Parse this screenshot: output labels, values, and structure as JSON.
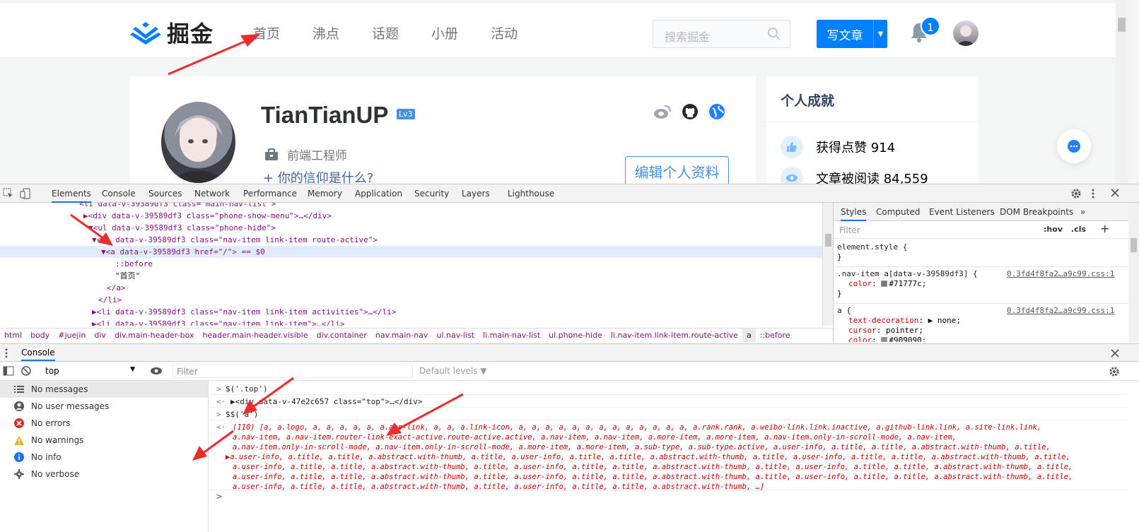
{
  "site": {
    "logo_text": "掘金",
    "nav": [
      "首页",
      "沸点",
      "话题",
      "小册",
      "活动"
    ],
    "search_placeholder": "搜索掘金",
    "write_button": "写文章",
    "notification_count": "1"
  },
  "profile": {
    "name": "TianTianUP",
    "level": "Lv3",
    "job": "前端工程师",
    "belief": "+ 你的信仰是什么?",
    "edit_button": "编辑个人资料"
  },
  "achievements": {
    "title": "个人成就",
    "likes": "获得点赞 914",
    "reads": "文章被阅读 84,559"
  },
  "devtools": {
    "tabs": [
      "Elements",
      "Console",
      "Sources",
      "Network",
      "Performance",
      "Memory",
      "Application",
      "Security",
      "Layers",
      "Lighthouse"
    ],
    "elements": [
      {
        "indent": 112,
        "html": "<li data-v-39589df3 class=\"main-nav-list\">"
      },
      {
        "indent": 118,
        "html": "▶<div data-v-39589df3 class=\"phone-show-menu\">…</div>"
      },
      {
        "indent": 125,
        "html": "▼<ul data-v-39589df3 class=\"phone-hide\">"
      },
      {
        "indent": 130,
        "html": "▼<li data-v-39589df3 class=\"nav-item link-item route-active\">"
      },
      {
        "indent": 143,
        "html": "▼<a data-v-39589df3 href=\"/\"> == $0"
      },
      {
        "indent": 163,
        "html": "::before"
      },
      {
        "indent": 163,
        "html": "\"首页\""
      },
      {
        "indent": 151,
        "html": "</a>"
      },
      {
        "indent": 139,
        "html": "</li>"
      },
      {
        "indent": 130,
        "html": "▶<li data-v-39589df3 class=\"nav-item link-item activities\">…</li>"
      },
      {
        "indent": 130,
        "html": "▶<li data-v-39589df3 class=\"nav-item link-item\">…</li>"
      }
    ],
    "breadcrumb": [
      "html",
      "body",
      "#juejin",
      "div",
      "div.main-header-box",
      "header.main-header.visible",
      "div.container",
      "nav.main-nav",
      "ul.nav-list",
      "li.main-nav-list",
      "ul.phone-hide",
      "li.nav-item.link-item.route-active",
      "a",
      "::before"
    ],
    "styles_tabs": [
      "Styles",
      "Computed",
      "Event Listeners",
      "DOM Breakpoints",
      "»"
    ],
    "styles_filter_placeholder": "Filter",
    "hov": ":hov",
    "cls": ".cls",
    "plus": "+",
    "rules": [
      {
        "selector": "element.style {",
        "props": [],
        "close": "}",
        "source": ""
      },
      {
        "selector": ".nav-item a[data-v-39589df3] {",
        "props": [
          {
            "name": "color",
            "value": "#71777c;",
            "swatch": "#71777c"
          }
        ],
        "close": "}",
        "source": "0.3fd4f8fa2…a9c99.css:1"
      },
      {
        "selector": "a {",
        "props": [
          {
            "name": "text-decoration",
            "value": "▶ none;",
            "swatch": ""
          },
          {
            "name": "cursor",
            "value": "pointer;",
            "swatch": ""
          },
          {
            "name": "color",
            "value": "#909090;",
            "swatch": "#909090"
          }
        ],
        "close": "",
        "source": "0.3fd4f8fa2…a9c99.css:1"
      }
    ]
  },
  "console": {
    "drawer_title": "Console",
    "context": "top",
    "filter_placeholder": "Filter",
    "levels": "Default levels ▼",
    "sidebar": [
      {
        "icon": "list-icon",
        "label": "No messages"
      },
      {
        "icon": "user-icon",
        "label": "No user messages"
      },
      {
        "icon": "error-icon",
        "label": "No errors"
      },
      {
        "icon": "warning-icon",
        "label": "No warnings"
      },
      {
        "icon": "info-icon",
        "label": "No info"
      },
      {
        "icon": "verbose-icon",
        "label": "No verbose"
      }
    ],
    "lines": [
      {
        "type": "input",
        "text": "$('.top')"
      },
      {
        "type": "result",
        "text": "▶<div data-v-47e2c657 class=\"top\">…</div>"
      },
      {
        "type": "input",
        "text": "$$('a')"
      }
    ],
    "array_result": [
      "(110) [a, a.logo, a, a, a, a, a, a.app-link, a, a, a.link-icon, a, a, a, a, a, a, a, a, a, a, a, a, a, a.rank.rank, a.weibo-link.link.inactive, a.github-link.link, a.site-link.link,",
      "a.nav-item, a.nav-item.router-link-exact-active.route-active.active, a.nav-item, a.nav-item, a.more-item, a.more-item, a.nav-item.only-in-scroll-mode, a.nav-item,",
      "a.nav-item.only-in-scroll-mode, a.nav-item.only-in-scroll-mode, a.more-item, a.more-item, a.sub-type, a.sub-type.active, a.user-info, a.title, a.title, a.abstract.with-thumb, a.title,",
      "a.user-info, a.title, a.title, a.abstract.with-thumb, a.title, a.user-info, a.title, a.title, a.abstract.with-thumb, a.title, a.user-info, a.title, a.title, a.abstract.with-thumb, a.title,",
      "a.user-info, a.title, a.title, a.abstract.with-thumb, a.title, a.user-info, a.title, a.title, a.abstract.with-thumb, a.title, a.user-info, a.title, a.title, a.abstract.with-thumb, a.title,",
      "a.user-info, a.title, a.title, a.abstract.with-thumb, a.title, a.user-info, a.title, a.title, a.abstract.with-thumb, a.title, a.user-info, a.title, a.title, a.abstract.with-thumb, a.title,",
      "a.user-info, a.title, a.title, a.abstract.with-thumb, a.title, a.user-info, a.title, a.title, a.abstract.with-thumb, …]"
    ],
    "prompt": ">"
  }
}
